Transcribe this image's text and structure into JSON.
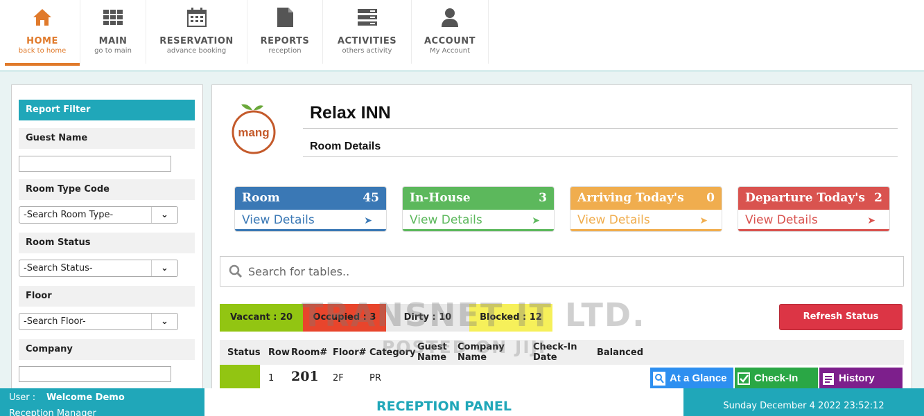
{
  "nav": [
    {
      "title": "HOME",
      "sub": "back to home"
    },
    {
      "title": "MAIN",
      "sub": "go to main"
    },
    {
      "title": "RESERVATION",
      "sub": "advance booking"
    },
    {
      "title": "REPORTS",
      "sub": "reception"
    },
    {
      "title": "ACTIVITIES",
      "sub": "others activity"
    },
    {
      "title": "ACCOUNT",
      "sub": "My Account"
    }
  ],
  "filter": {
    "header": "Report Filter",
    "guest_label": "Guest Name",
    "guest_value": "",
    "room_type_label": "Room Type Code",
    "room_type_value": "-Search Room Type-",
    "status_label": "Room Status",
    "status_value": "-Search Status-",
    "floor_label": "Floor",
    "floor_value": "-Search Floor-",
    "company_label": "Company",
    "company_value": ""
  },
  "main": {
    "hotel_name": "Relax INN",
    "logo_text": "mang",
    "subtitle": "Room Details",
    "cards": [
      {
        "title": "Room",
        "count": "45",
        "link": "View Details",
        "color": "#3a78b5"
      },
      {
        "title": "In-House",
        "count": "3",
        "link": "View Details",
        "color": "#5cb85c"
      },
      {
        "title": "Arriving Today's",
        "count": "0",
        "link": "View Details",
        "color": "#f0ad4e"
      },
      {
        "title": "Departure Today's",
        "count": "2",
        "link": "View Details",
        "color": "#d9534f"
      }
    ],
    "search_placeholder": "Search for tables..",
    "status_bars": [
      {
        "label": "Vaccant : 20",
        "color": "#92c512"
      },
      {
        "label": "Occupied : 3",
        "color": "#e8452c"
      },
      {
        "label": "Dirty : 10",
        "color": "#e9e9e9"
      },
      {
        "label": "Blocked : 12",
        "color": "#f6f05a"
      }
    ],
    "refresh_label": "Refresh Status",
    "columns": [
      "Status",
      "Row",
      "Room#",
      "Floor#",
      "Category",
      "Guest Name",
      "Company Name",
      "Check-In Date",
      "Balanced"
    ],
    "rows": [
      {
        "row": "1",
        "room": "201",
        "floor": "2F",
        "category": "PR",
        "guest": "",
        "company": "",
        "checkin": "",
        "balanced": ""
      }
    ],
    "actions": [
      {
        "label": "At a Glance",
        "color": "#2d8ff0"
      },
      {
        "label": "Check-In",
        "color": "#2aa745"
      },
      {
        "label": "History",
        "color": "#7d1f8c"
      }
    ],
    "watermark": "TRANSNET IT LTD.",
    "watermark_sub": "POSTED ON JIJI"
  },
  "footer": {
    "user_label": "User :",
    "user_name": "Welcome Demo",
    "role": "Reception Manager",
    "panel": "RECEPTION PANEL",
    "datetime": "Sunday December 4 2022 23:52:12"
  }
}
